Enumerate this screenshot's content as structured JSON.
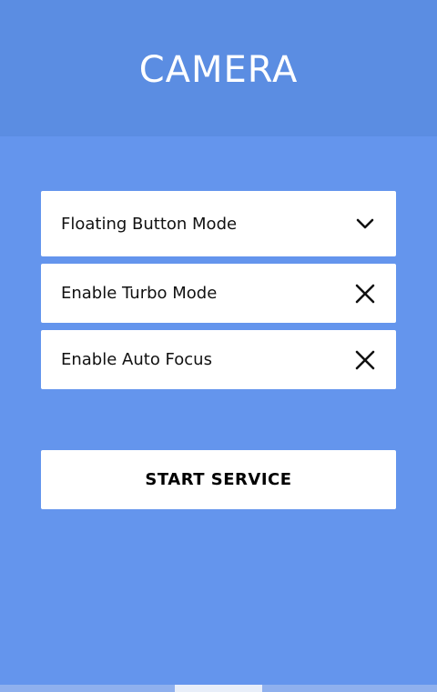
{
  "header": {
    "title": "CAMERA"
  },
  "options": [
    {
      "label": "Floating Button Mode",
      "icon": "chevron-down-icon"
    },
    {
      "label": "Enable Turbo Mode",
      "icon": "close-icon"
    },
    {
      "label": "Enable Auto Focus",
      "icon": "close-icon"
    }
  ],
  "actions": {
    "start_label": "START SERVICE"
  },
  "pager": {
    "pages": 5,
    "active_page": 3
  },
  "colors": {
    "background": "#6495ed",
    "header": "#5b8de2",
    "card": "#ffffff",
    "pager_inactive": "#8fb0ee",
    "pager_active": "#e8eef9"
  }
}
